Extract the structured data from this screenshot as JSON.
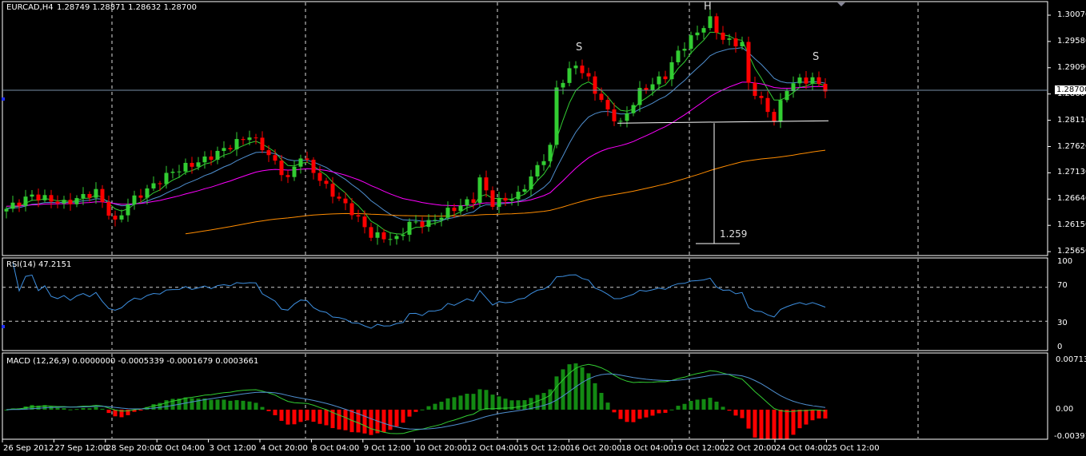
{
  "header": {
    "symbol_tf": "EURCAD,H4",
    "ohlc": "1.28749 1.28871 1.28632 1.28700"
  },
  "current_price": "1.28700",
  "price_axis": [
    "1.30070",
    "1.29580",
    "1.29090",
    "1.28600",
    "1.28110",
    "1.27620",
    "1.27130",
    "1.26640",
    "1.26150",
    "1.25650"
  ],
  "rsi": {
    "title": "RSI(14) 47.2151",
    "levels": [
      "100",
      "70",
      "30",
      "0"
    ]
  },
  "macd": {
    "title": "MACD  (12,26,9) 0.0000000 -0.0005339 -0.0001679 0.0003661",
    "levels": [
      "0.007130",
      "0.00",
      "-0.00391"
    ]
  },
  "time_axis": [
    "26 Sep 2012",
    "27 Sep 12:00",
    "28 Sep 20:00",
    "2 Oct 04:00",
    "3 Oct 12:00",
    "4 Oct 20:00",
    "8 Oct 04:00",
    "9 Oct 12:00",
    "10 Oct 20:00",
    "12 Oct 04:00",
    "15 Oct 12:00",
    "16 Oct 20:00",
    "18 Oct 04:00",
    "19 Oct 12:00",
    "22 Oct 20:00",
    "24 Oct 04:00",
    "25 Oct 12:00"
  ],
  "annotations": {
    "left_shoulder": "S",
    "head": "H",
    "right_shoulder": "S",
    "target": "1.259"
  },
  "colors": {
    "bull": "#32cd32",
    "bear": "#ff0000",
    "ma_fast": "#32cd32",
    "ma_mid": "#4f8fd0",
    "ma_slow": "#ff00ff",
    "ma_long": "#ff8c00",
    "price_line": "#7890a8"
  },
  "chart_data": {
    "type": "candlestick",
    "title": "EURCAD,H4",
    "price_range": [
      1.2565,
      1.3007
    ],
    "bar_count": 129,
    "close_anchors": [
      [
        0,
        1.2645
      ],
      [
        4,
        1.267
      ],
      [
        9,
        1.2655
      ],
      [
        14,
        1.2677
      ],
      [
        17,
        1.2618
      ],
      [
        19,
        1.2655
      ],
      [
        26,
        1.2715
      ],
      [
        31,
        1.2737
      ],
      [
        38,
        1.2782
      ],
      [
        40,
        1.276
      ],
      [
        44,
        1.27
      ],
      [
        46,
        1.2745
      ],
      [
        50,
        1.2685
      ],
      [
        54,
        1.264
      ],
      [
        57,
        1.2596
      ],
      [
        61,
        1.2588
      ],
      [
        63,
        1.2618
      ],
      [
        66,
        1.2618
      ],
      [
        69,
        1.264
      ],
      [
        73,
        1.2663
      ],
      [
        74,
        1.27
      ],
      [
        76,
        1.2655
      ],
      [
        80,
        1.267
      ],
      [
        83,
        1.2722
      ],
      [
        85,
        1.276
      ],
      [
        86,
        1.2871
      ],
      [
        89,
        1.2916
      ],
      [
        91,
        1.2886
      ],
      [
        94,
        1.2827
      ],
      [
        96,
        1.2804
      ],
      [
        99,
        1.2864
      ],
      [
        103,
        1.2894
      ],
      [
        105,
        1.2938
      ],
      [
        108,
        1.2976
      ],
      [
        110,
        1.2998
      ],
      [
        112,
        1.2961
      ],
      [
        115,
        1.2953
      ],
      [
        116,
        1.2879
      ],
      [
        120,
        1.2812
      ],
      [
        122,
        1.2871
      ],
      [
        124,
        1.2886
      ],
      [
        126,
        1.2886
      ],
      [
        128,
        1.287
      ]
    ],
    "neckline": 1.2805,
    "target_price": 1.259
  }
}
